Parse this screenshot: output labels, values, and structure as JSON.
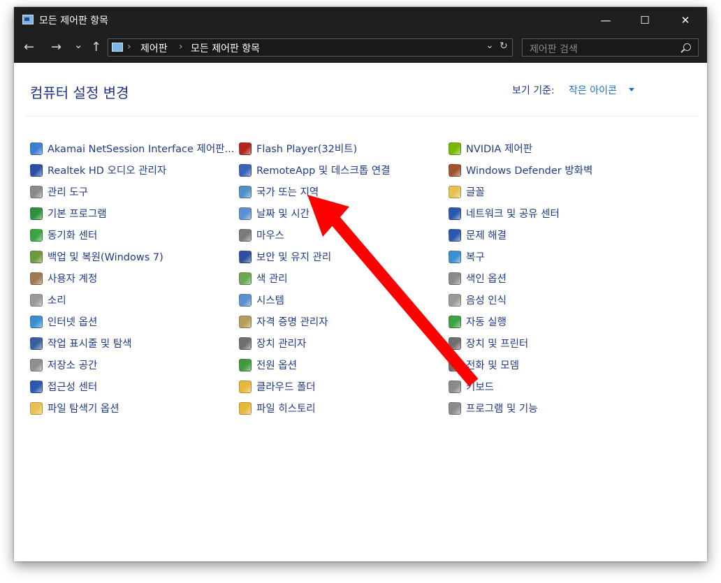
{
  "window": {
    "title": "모든 제어판 항목",
    "minimize_glyph": "—",
    "maximize_glyph": "☐",
    "close_glyph": "✕"
  },
  "nav": {
    "back": "←",
    "forward": "→",
    "recent": "⌄",
    "up": "↑",
    "sep": "›",
    "dropdown": "⌄",
    "refresh": "↻"
  },
  "breadcrumb": [
    "제어판",
    "모든 제어판 항목"
  ],
  "search": {
    "placeholder": "제어판 검색"
  },
  "header": {
    "title": "컴퓨터 설정 변경",
    "view_by_label": "보기 기준:",
    "view_by_value": "작은 아이콘"
  },
  "columns": [
    [
      {
        "label": "Akamai NetSession Interface 제어판...",
        "icon": "akamai-icon",
        "color": "#3b7fd0"
      },
      {
        "label": "Realtek HD 오디오 관리자",
        "icon": "realtek-audio-icon",
        "color": "#2d4fa8"
      },
      {
        "label": "관리 도구",
        "icon": "admin-tools-icon",
        "color": "#8a8a8a"
      },
      {
        "label": "기본 프로그램",
        "icon": "default-programs-icon",
        "color": "#2f8f3f"
      },
      {
        "label": "동기화 센터",
        "icon": "sync-center-icon",
        "color": "#3ca341"
      },
      {
        "label": "백업 및 복원(Windows 7)",
        "icon": "backup-restore-icon",
        "color": "#6d9a3c"
      },
      {
        "label": "사용자 계정",
        "icon": "user-accounts-icon",
        "color": "#a07850"
      },
      {
        "label": "소리",
        "icon": "sound-icon",
        "color": "#9a9a9a"
      },
      {
        "label": "인터넷 옵션",
        "icon": "internet-options-icon",
        "color": "#3b8fd0"
      },
      {
        "label": "작업 표시줄 및 탐색",
        "icon": "taskbar-icon",
        "color": "#3a5fa0"
      },
      {
        "label": "저장소 공간",
        "icon": "storage-spaces-icon",
        "color": "#8f8f8f"
      },
      {
        "label": "접근성 센터",
        "icon": "ease-of-access-icon",
        "color": "#2a58b0"
      },
      {
        "label": "파일 탐색기 옵션",
        "icon": "file-explorer-options-icon",
        "color": "#e8c150"
      }
    ],
    [
      {
        "label": "Flash Player(32비트)",
        "icon": "flash-player-icon",
        "color": "#b3261e"
      },
      {
        "label": "RemoteApp 및 데스크톱 연결",
        "icon": "remoteapp-icon",
        "color": "#3a62b8"
      },
      {
        "label": "국가 또는 지역",
        "icon": "region-icon",
        "color": "#4f91c8"
      },
      {
        "label": "날짜 및 시간",
        "icon": "date-time-icon",
        "color": "#5b8fd0"
      },
      {
        "label": "마우스",
        "icon": "mouse-icon",
        "color": "#7a7a7a"
      },
      {
        "label": "보안 및 유지 관리",
        "icon": "security-maintenance-icon",
        "color": "#2c4fa0"
      },
      {
        "label": "색 관리",
        "icon": "color-management-icon",
        "color": "#6aa84f"
      },
      {
        "label": "시스템",
        "icon": "system-icon",
        "color": "#5b8fd0"
      },
      {
        "label": "자격 증명 관리자",
        "icon": "credential-manager-icon",
        "color": "#b89b5e"
      },
      {
        "label": "장치 관리자",
        "icon": "device-manager-icon",
        "color": "#6f6f6f"
      },
      {
        "label": "전원 옵션",
        "icon": "power-options-icon",
        "color": "#3e9a3e"
      },
      {
        "label": "클라우드 폴더",
        "icon": "cloud-folder-icon",
        "color": "#e8b83a"
      },
      {
        "label": "파일 히스토리",
        "icon": "file-history-icon",
        "color": "#e8b83a"
      }
    ],
    [
      {
        "label": "NVIDIA 제어판",
        "icon": "nvidia-icon",
        "color": "#76b900"
      },
      {
        "label": "Windows Defender 방화벽",
        "icon": "firewall-icon",
        "color": "#a0522d"
      },
      {
        "label": "글꼴",
        "icon": "fonts-icon",
        "color": "#e8c150"
      },
      {
        "label": "네트워크 및 공유 센터",
        "icon": "network-sharing-icon",
        "color": "#2a58b0"
      },
      {
        "label": "문제 해결",
        "icon": "troubleshooting-icon",
        "color": "#2a58b0"
      },
      {
        "label": "복구",
        "icon": "recovery-icon",
        "color": "#3b8fd0"
      },
      {
        "label": "색인 옵션",
        "icon": "indexing-options-icon",
        "color": "#8a8a8a"
      },
      {
        "label": "음성 인식",
        "icon": "speech-recognition-icon",
        "color": "#9a9a9a"
      },
      {
        "label": "자동 실행",
        "icon": "autoplay-icon",
        "color": "#3ca341"
      },
      {
        "label": "장치 및 프린터",
        "icon": "devices-printers-icon",
        "color": "#6f6f6f"
      },
      {
        "label": "전화 및 모뎀",
        "icon": "phone-modem-icon",
        "color": "#6f6f6f"
      },
      {
        "label": "키보드",
        "icon": "keyboard-icon",
        "color": "#8a8a8a"
      },
      {
        "label": "프로그램 및 기능",
        "icon": "programs-features-icon",
        "color": "#8a8a8a"
      }
    ]
  ],
  "annotation": {
    "color": "#ff0000"
  }
}
